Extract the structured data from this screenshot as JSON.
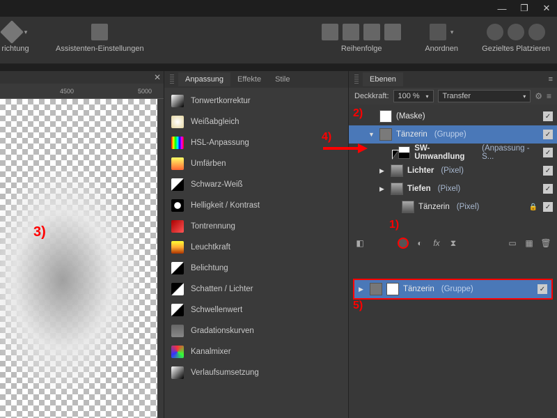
{
  "titlebar": {
    "min": "—",
    "max": "❐",
    "close": "✕"
  },
  "toolbar": {
    "items": [
      {
        "label": "richtung"
      },
      {
        "label": "Assistenten-Einstellungen"
      },
      {
        "label": "Reihenfolge"
      },
      {
        "label": "Anordnen"
      },
      {
        "label": "Gezieltes Platzieren"
      }
    ]
  },
  "ruler": {
    "t1": "4500",
    "t2": "5000"
  },
  "adj": {
    "tabs": {
      "a": "Anpassung",
      "b": "Effekte",
      "c": "Stile"
    },
    "items": [
      {
        "label": "Tonwertkorrektur",
        "bg": "linear-gradient(135deg,#fff,#000)"
      },
      {
        "label": "Weißabgleich",
        "bg": "radial-gradient(circle,#fff,#e4d5a0)"
      },
      {
        "label": "HSL-Anpassung",
        "bg": "linear-gradient(90deg,#f00,#ff0,#0f0,#0ff,#00f,#f0f,#f00)"
      },
      {
        "label": "Umfärben",
        "bg": "linear-gradient(#ff6,#f63)"
      },
      {
        "label": "Schwarz-Weiß",
        "bg": "linear-gradient(135deg,#fff 48%,#000 52%)"
      },
      {
        "label": "Helligkeit / Kontrast",
        "bg": "radial-gradient(circle,#fff 35%,#000 40%)"
      },
      {
        "label": "Tontrennung",
        "bg": "linear-gradient(135deg,#a00,#f55)"
      },
      {
        "label": "Leuchtkraft",
        "bg": "linear-gradient(#ff3,#fa3,#a30)"
      },
      {
        "label": "Belichtung",
        "bg": "linear-gradient(135deg,#fff 48%,#000 52%)"
      },
      {
        "label": "Schatten / Lichter",
        "bg": "linear-gradient(135deg,#000 48%,#fff 52%)"
      },
      {
        "label": "Schwellenwert",
        "bg": "linear-gradient(135deg,#fff 48%,#000 52%)"
      },
      {
        "label": "Gradationskurven",
        "bg": "linear-gradient(#666,#888)"
      },
      {
        "label": "Kanalmixer",
        "bg": "conic-gradient(#f33,#3f3,#33f,#f33)"
      },
      {
        "label": "Verlaufsumsetzung",
        "bg": "linear-gradient(135deg,#fff,#000)"
      }
    ]
  },
  "layers": {
    "title": "Ebenen",
    "opacityLabel": "Deckkraft:",
    "opacity": "100 %",
    "blend": "Transfer",
    "rows": [
      {
        "name": "(Maske)",
        "suffix": "",
        "indent": 16,
        "thumbs": [
          "mask"
        ],
        "checked": true,
        "annN": "2)"
      },
      {
        "name": "Tänzerin",
        "suffix": "(Gruppe)",
        "indent": 16,
        "selected": true,
        "disclosure": "▼",
        "thumbs": [
          "grp"
        ],
        "checked": true,
        "annN": "4)"
      },
      {
        "name": "SW-Umwandlung",
        "suffix": "(Anpassung - S...",
        "indent": 48,
        "thumbs": [
          "bw"
        ],
        "checked": true,
        "bold": true
      },
      {
        "name": "Lichter",
        "suffix": "(Pixel)",
        "indent": 32,
        "disclosure": "▶",
        "thumbs": [
          "img"
        ],
        "checked": true,
        "bold": true
      },
      {
        "name": "Tiefen",
        "suffix": "(Pixel)",
        "indent": 32,
        "disclosure": "▶",
        "thumbs": [
          "img"
        ],
        "checked": true,
        "bold": true
      },
      {
        "name": "Tänzerin",
        "suffix": "(Pixel)",
        "indent": 48,
        "thumbs": [
          "img"
        ],
        "checked": true,
        "locked": true
      }
    ],
    "bottom": {
      "name": "Tänzerin",
      "suffix": "(Gruppe)",
      "checked": true
    }
  },
  "annotations": {
    "a1": "1)",
    "a3": "3)",
    "a5": "5)"
  }
}
